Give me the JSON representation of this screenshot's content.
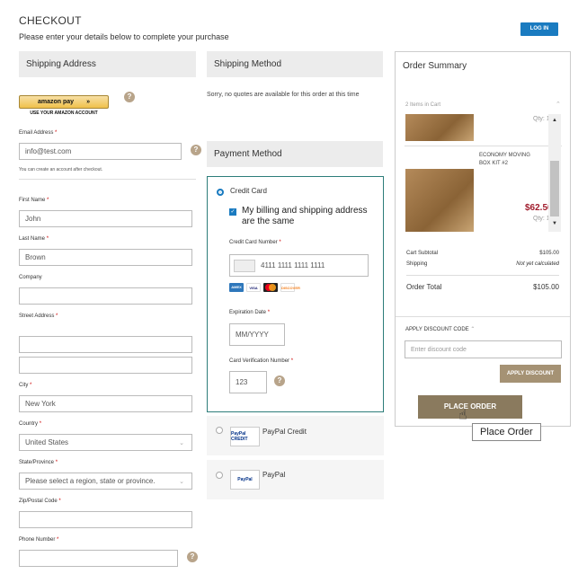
{
  "page": {
    "title": "CHECKOUT",
    "subtitle": "Please enter your details below to complete your purchase",
    "login_label": "LOG IN"
  },
  "shipping_address": {
    "heading": "Shipping Address",
    "amazon_pay_label": "amazon pay",
    "amazon_pay_sub": "USE YOUR AMAZON ACCOUNT",
    "email": {
      "label": "Email Address",
      "value": "info@test.com",
      "hint": "You can create an account after checkout."
    },
    "first_name": {
      "label": "First Name",
      "value": "John"
    },
    "last_name": {
      "label": "Last Name",
      "value": "Brown"
    },
    "company": {
      "label": "Company",
      "value": ""
    },
    "street": {
      "label": "Street Address",
      "line1": "",
      "line2": ""
    },
    "city": {
      "label": "City",
      "value": "New York"
    },
    "country": {
      "label": "Country",
      "value": "United States"
    },
    "state": {
      "label": "State/Province",
      "value": "Please select a region, state or province."
    },
    "zip": {
      "label": "Zip/Postal Code",
      "value": ""
    },
    "phone": {
      "label": "Phone Number",
      "value": ""
    }
  },
  "shipping_method": {
    "heading": "Shipping Method",
    "message": "Sorry, no quotes are available for this order at this time"
  },
  "payment_method": {
    "heading": "Payment Method",
    "credit_card": {
      "label": "Credit Card",
      "billing_same_label": "My billing and shipping address are the same",
      "number_label": "Credit Card Number",
      "number_value": "4111 1111 1111 1111",
      "card_brands": [
        "AMEX",
        "VISA",
        "MC",
        "DISCOVER"
      ],
      "exp_label": "Expiration Date",
      "exp_placeholder": "MM/YYYY",
      "cvv_label": "Card Verification Number",
      "cvv_value": "123"
    },
    "paypal_credit_label": "PayPal Credit",
    "paypal_credit_logo": "PayPal CREDIT",
    "paypal_label": "PayPal",
    "paypal_logo": "PayPal"
  },
  "order_summary": {
    "heading": "Order Summary",
    "items_in_cart": "2 Items in Cart",
    "item1": {
      "qty_label": "Qty:",
      "qty": "1"
    },
    "item2": {
      "name": "ECONOMY MOVING BOX KIT #2",
      "price": "$62.50",
      "qty_label": "Qty:",
      "qty": "1"
    },
    "cart_subtotal_label": "Cart Subtotal",
    "cart_subtotal_value": "$105.00",
    "shipping_label": "Shipping",
    "shipping_value": "Not yet calculated",
    "order_total_label": "Order Total",
    "order_total_value": "$105.00",
    "discount_label": "APPLY DISCOUNT CODE",
    "discount_placeholder": "Enter discount code",
    "apply_label": "APPLY DISCOUNT",
    "place_order_label": "PLACE ORDER",
    "tooltip": "Place Order"
  },
  "colors": {
    "primary_blue": "#1a7bc0",
    "accent_tan": "#8a7a5e",
    "price_red": "#a01c2c",
    "payment_border": "#2d7d7a"
  }
}
